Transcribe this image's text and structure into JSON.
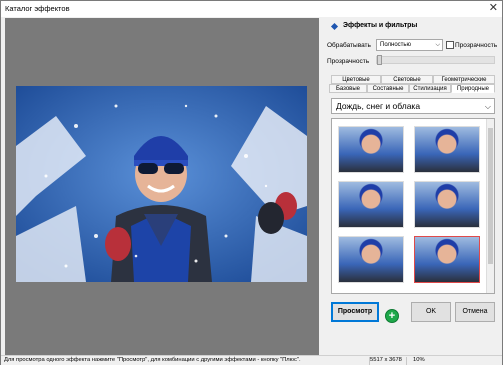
{
  "window": {
    "title": "Каталог эффектов"
  },
  "panel": {
    "header": "Эффекты и фильтры",
    "process_label": "Обрабатывать",
    "process_value": "Полностью",
    "transparency_check_label": "Прозрачность",
    "transparency_label": "Прозрачность",
    "tabs_row1": [
      "Цветовые",
      "Световые",
      "Геометрические"
    ],
    "tabs_row2": [
      "Базовые",
      "Составные",
      "Стилизация",
      "Природные"
    ],
    "active_tab": "Природные",
    "category_value": "Дождь, снег и облака"
  },
  "buttons": {
    "preview": "Просмотр",
    "plus": "+",
    "ok": "OK",
    "cancel": "Отмена"
  },
  "status": {
    "hint": "Для просмотра одного эффекта нажмите \"Просмотр\", для комбинации с другими эффектами - кнопку \"Плюс\".",
    "dimensions": "5517 x 3678",
    "zoom": "10%"
  },
  "colors": {
    "accent": "#0078d7",
    "selection": "#e04a4a",
    "plus_green": "#1ea84a",
    "preview_bg": "#7a7a7a"
  }
}
